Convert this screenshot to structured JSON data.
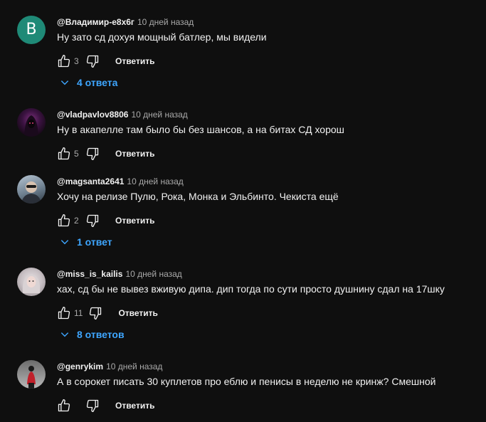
{
  "comments": [
    {
      "avatar_letter": "В",
      "avatar_color": "#1f8a77",
      "author": "@Владимир-е8х6г",
      "time": "10 дней назад",
      "text": "Ну зато сд дохуя мощный батлер, мы видели",
      "likes": "3",
      "reply_label": "Ответить",
      "replies_label": "4 ответа"
    },
    {
      "author": "@vladpavlov8806",
      "time": "10 дней назад",
      "text": "Ну в акапелле там было бы без шансов, а на битах СД хорош",
      "likes": "5",
      "reply_label": "Ответить"
    },
    {
      "author": "@magsanta2641",
      "time": "10 дней назад",
      "text": "Хочу на релизе Пулю, Рока, Монка и Эльбинто. Чекиста ещё",
      "likes": "2",
      "reply_label": "Ответить",
      "replies_label": "1 ответ"
    },
    {
      "author": "@miss_is_kailis",
      "time": "10 дней назад",
      "text": "хах, сд бы не вывез вживую дипа. дип тогда по сути просто душнину сдал на 17шку",
      "likes": "11",
      "reply_label": "Ответить",
      "replies_label": "8 ответов"
    },
    {
      "author": "@genrykim",
      "time": "10 дней назад",
      "text": "А в сорокет писать 30 куплетов про еблю и пенисы в неделю не кринж? Смешной",
      "likes": "",
      "reply_label": "Ответить"
    }
  ],
  "colors": {
    "background": "#0f0f0f",
    "link": "#3ea6ff",
    "secondary_text": "#aaaaaa"
  }
}
